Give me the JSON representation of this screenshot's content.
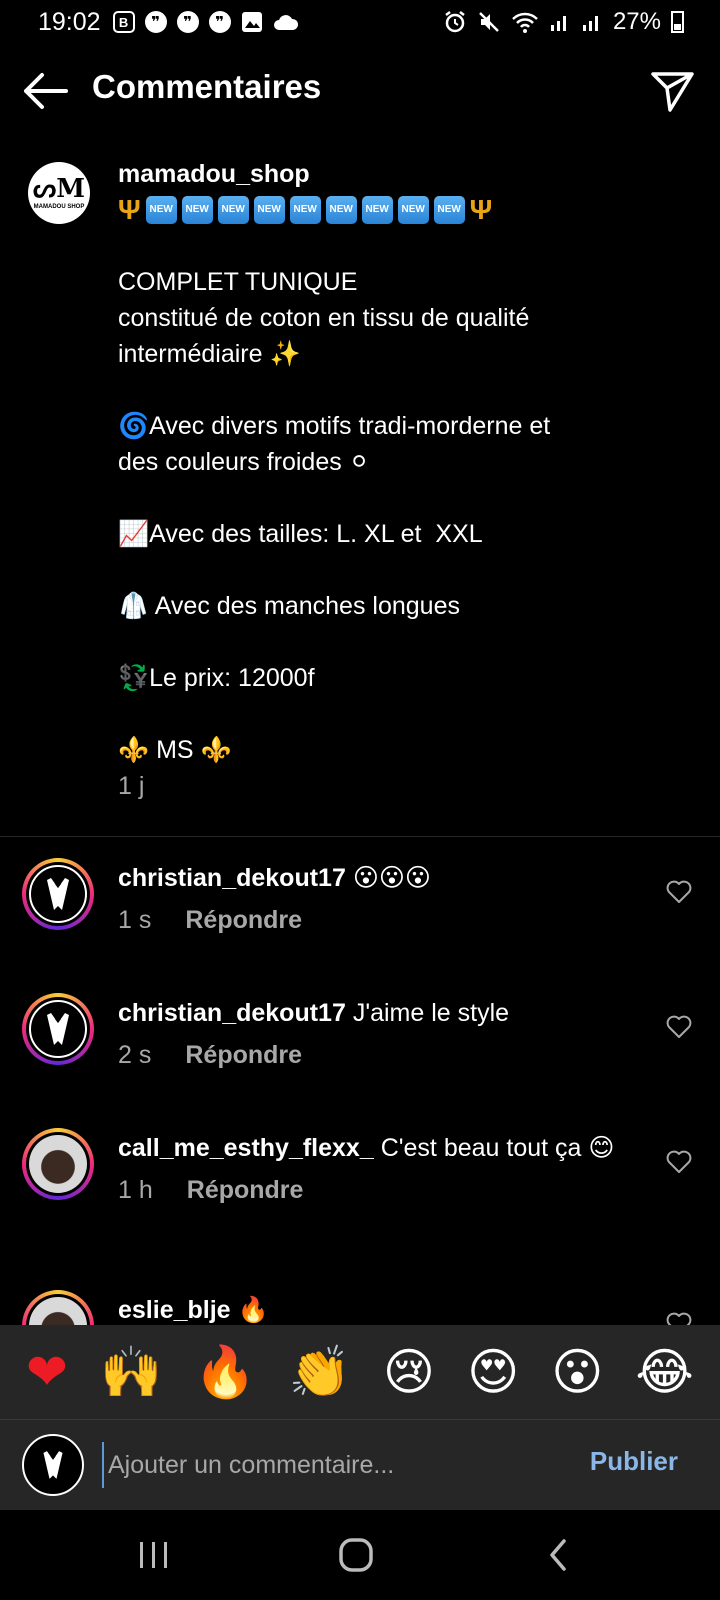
{
  "status_bar": {
    "time": "19:02",
    "battery": "27%"
  },
  "header": {
    "title": "Commentaires"
  },
  "caption": {
    "username": "mamadou_shop",
    "avatar_text": "MAMADOU SHOP",
    "new_badge": "NEW",
    "lines": {
      "l1": "COMPLET TUNIQUE",
      "l2": "constitué de coton en tissu de qualité",
      "l3": "intermédiaire ✨",
      "l4": "🌀Avec divers motifs tradi-morderne et",
      "l5": "des couleurs froides ⚪",
      "l6": "📈Avec des tailles: L. XL et  XXL",
      "l7": "🥼 Avec des manches longues",
      "l8": "💱Le prix: 12000f",
      "l9": "⚜️ MS ⚜️"
    },
    "time": "1 j"
  },
  "comments": [
    {
      "username": "christian_dekout17",
      "text": "😮😮😮",
      "time": "1 s",
      "reply": "Répondre"
    },
    {
      "username": "christian_dekout17",
      "text": "J'aime le style",
      "time": "2 s",
      "reply": "Répondre"
    },
    {
      "username": "call_me_esthy_flexx_",
      "text": "C'est beau tout ça 😊",
      "time": "1 h",
      "reply": "Répondre"
    },
    {
      "username": "eslie_blje",
      "text": "🔥"
    }
  ],
  "emoji_bar": [
    "❤",
    "🙌",
    "🔥",
    "👏",
    "😢",
    "😍",
    "😮",
    "😂"
  ],
  "input": {
    "placeholder": "Ajouter un commentaire...",
    "publish_label": "Publier"
  },
  "colors": {
    "background": "#000000",
    "secondary_text": "#a8a8a8",
    "link_blue": "#8bb7e8",
    "panel": "#262626"
  }
}
